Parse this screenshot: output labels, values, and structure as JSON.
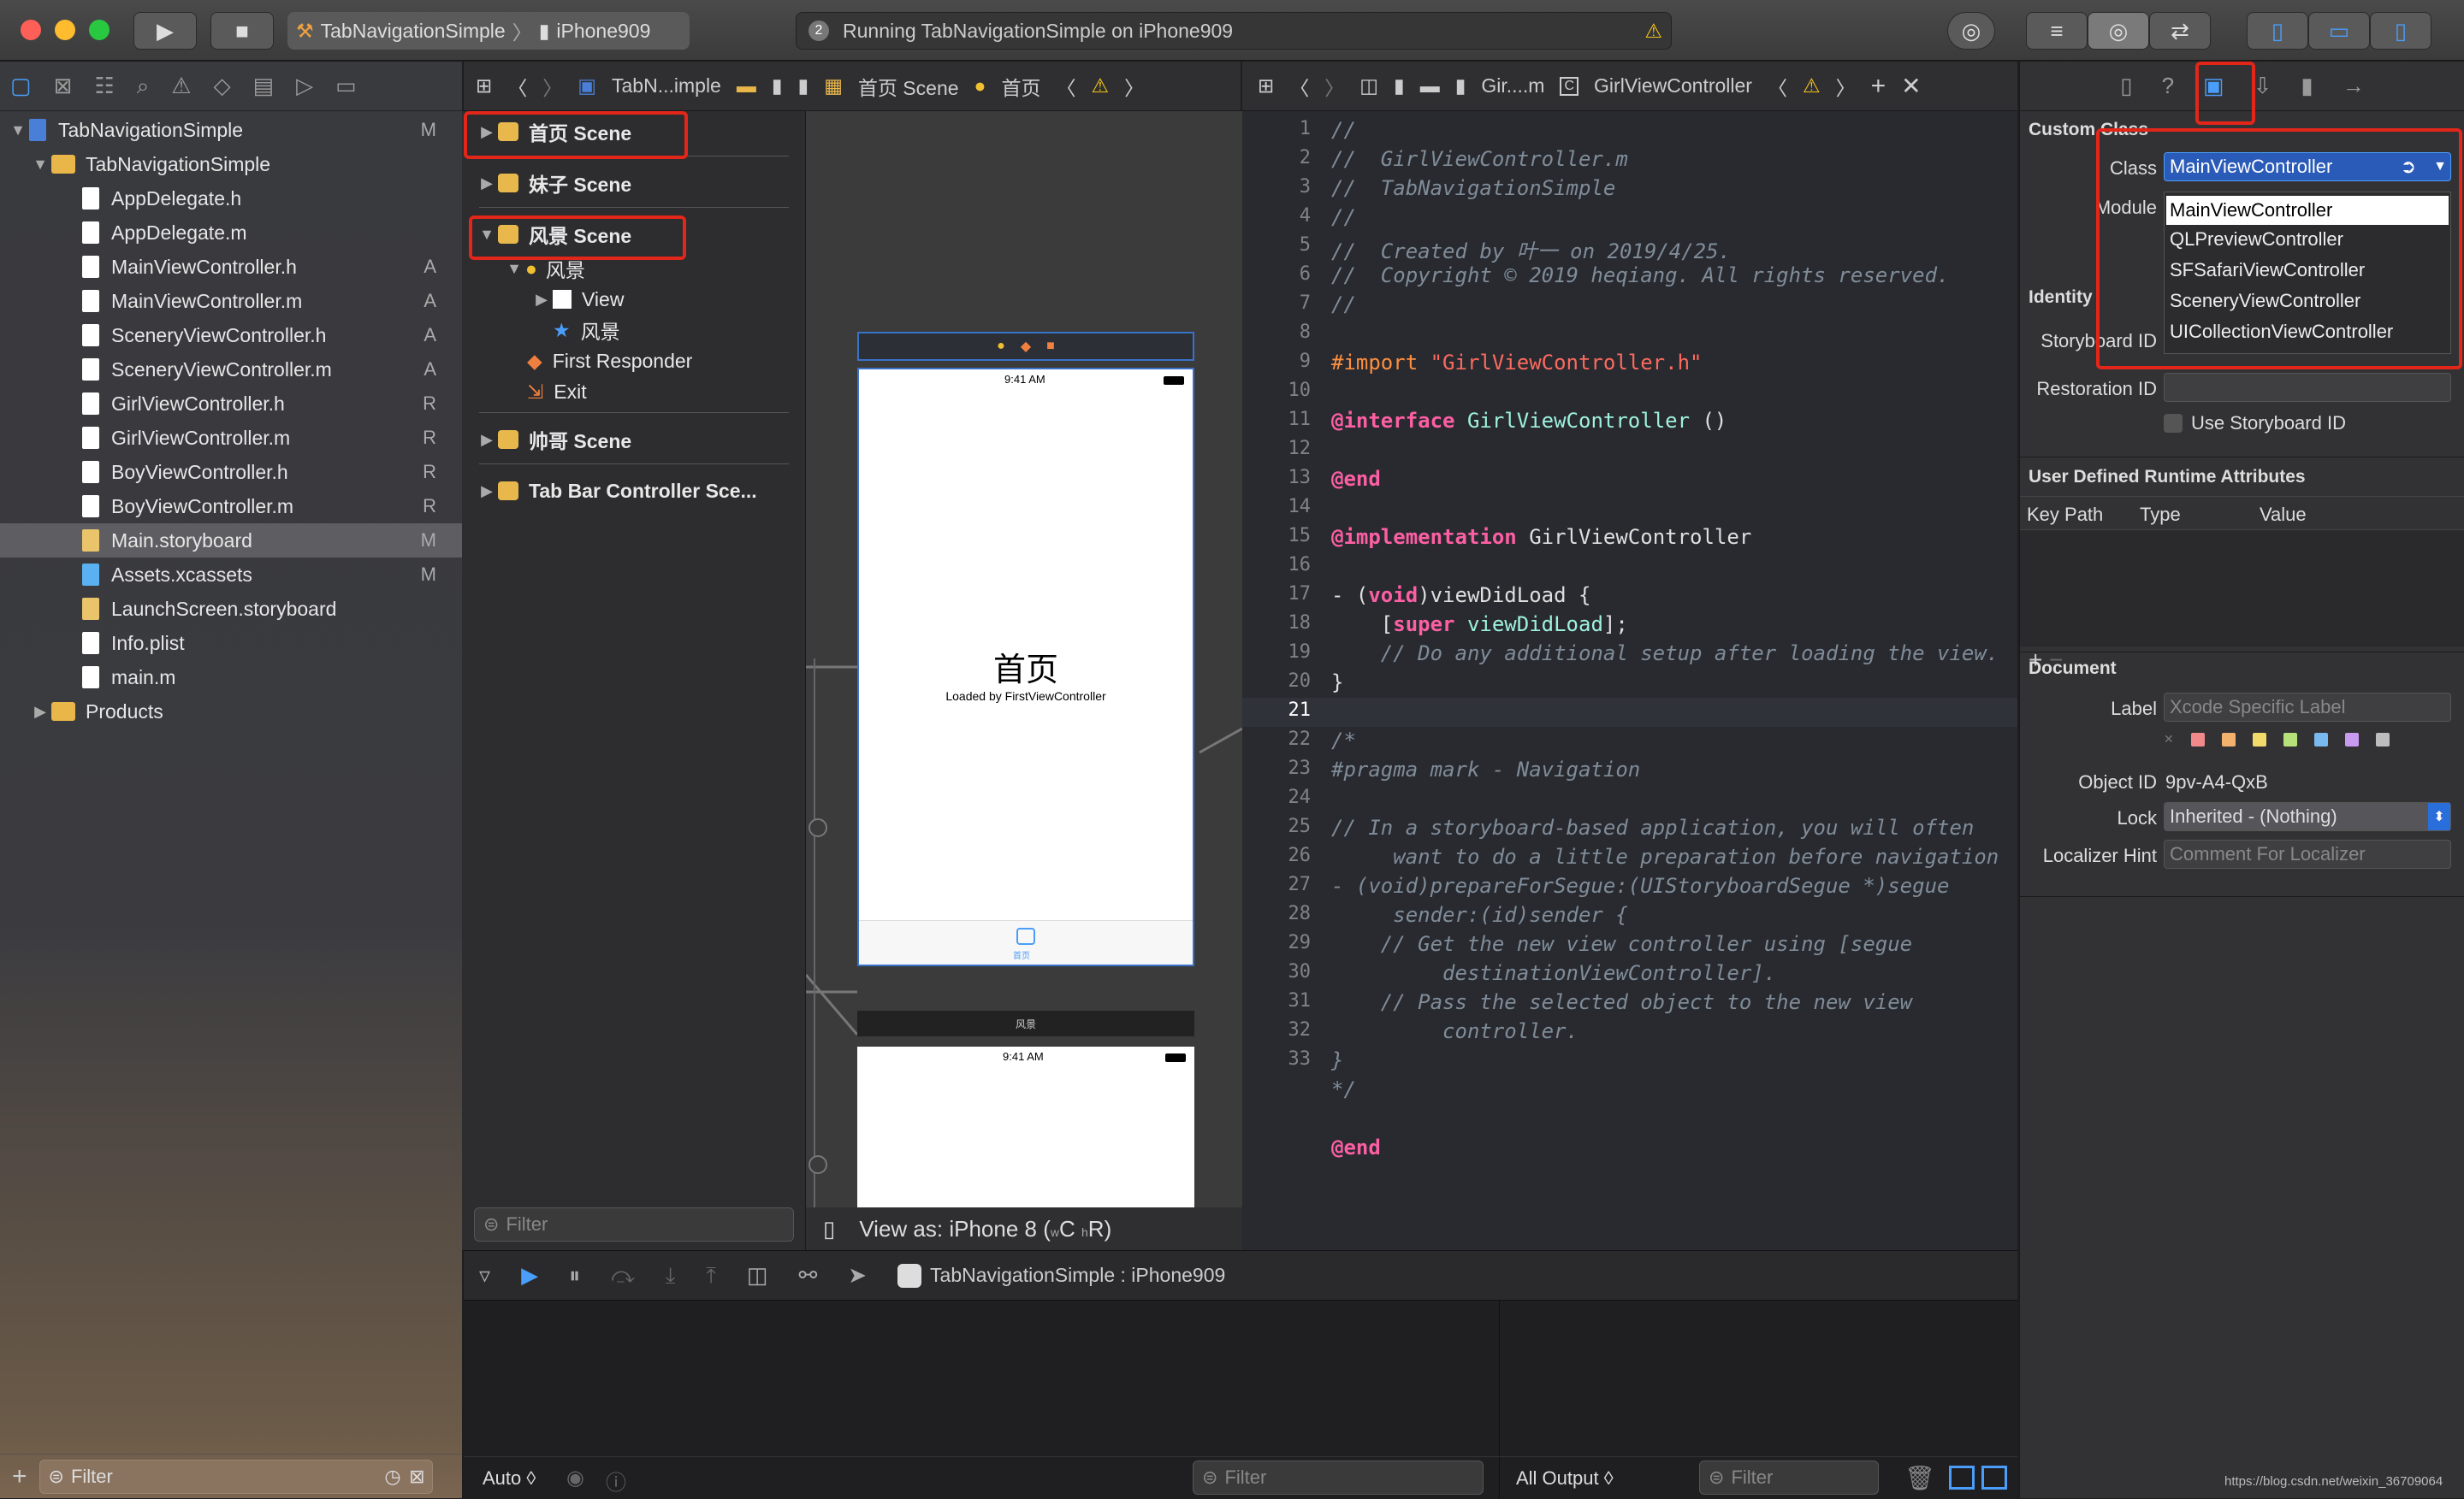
{
  "titlebar": {
    "scheme": "TabNavigationSimple",
    "device": "iPhone909",
    "status_count": "2",
    "status": "Running TabNavigationSimple on iPhone909"
  },
  "navigator": {
    "items": [
      {
        "label": "TabNavigationSimple",
        "status": "M"
      },
      {
        "label": "TabNavigationSimple",
        "status": ""
      },
      {
        "label": "AppDelegate.h",
        "status": ""
      },
      {
        "label": "AppDelegate.m",
        "status": ""
      },
      {
        "label": "MainViewController.h",
        "status": "A"
      },
      {
        "label": "MainViewController.m",
        "status": "A"
      },
      {
        "label": "SceneryViewController.h",
        "status": "A"
      },
      {
        "label": "SceneryViewController.m",
        "status": "A"
      },
      {
        "label": "GirlViewController.h",
        "status": "R"
      },
      {
        "label": "GirlViewController.m",
        "status": "R"
      },
      {
        "label": "BoyViewController.h",
        "status": "R"
      },
      {
        "label": "BoyViewController.m",
        "status": "R"
      },
      {
        "label": "Main.storyboard",
        "status": "M"
      },
      {
        "label": "Assets.xcassets",
        "status": "M"
      },
      {
        "label": "LaunchScreen.storyboard",
        "status": ""
      },
      {
        "label": "Info.plist",
        "status": ""
      },
      {
        "label": "main.m",
        "status": ""
      },
      {
        "label": "Products",
        "status": ""
      }
    ],
    "filter_placeholder": "Filter"
  },
  "storyboard": {
    "jumpbar": [
      "TabN...imple",
      "首页 Scene",
      "首页"
    ],
    "outline": [
      "首页 Scene",
      "妹子 Scene",
      "风景 Scene",
      "风景",
      "View",
      "风景",
      "First Responder",
      "Exit",
      "帅哥 Scene",
      "Tab Bar Controller Sce..."
    ],
    "filter_placeholder": "Filter",
    "view_as": "View as: iPhone 8 (",
    "view_as_suffix": "C",
    "view_as_end": "R)",
    "phone1": {
      "time": "9:41 AM",
      "title": "首页",
      "subtitle": "Loaded by FirstViewController",
      "tab": "首页"
    },
    "phone2": {
      "header": "风景",
      "time": "9:41 AM"
    }
  },
  "editor": {
    "jumpbar": [
      "Gir....m",
      "GirlViewController"
    ],
    "lines": [
      "1",
      "2",
      "3",
      "4",
      "5",
      "6",
      "7",
      "8",
      "9",
      "10",
      "11",
      "12",
      "13",
      "14",
      "15",
      "16",
      "17",
      "18",
      "19",
      "20",
      "21",
      "22",
      "23",
      "24",
      "25",
      "26",
      "27",
      "28",
      "29",
      "30",
      "31",
      "32",
      "33"
    ],
    "code": {
      "l1": "//",
      "l2": "//  GirlViewController.m",
      "l3": "//  TabNavigationSimple",
      "l4": "//",
      "l5": "//  Created by 叶一 on 2019/4/25.",
      "l6": "//  Copyright © 2019 heqiang. All rights reserved.",
      "l7": "//",
      "l9a": "#import ",
      "l9b": "\"GirlViewController.h\"",
      "l11a": "@interface",
      "l11b": " GirlViewController ",
      "l11c": "()",
      "l13": "@end",
      "l15a": "@implementation",
      "l15b": " GirlViewController",
      "l17a": "- (",
      "l17b": "void",
      "l17c": ")viewDidLoad {",
      "l18a": "    [",
      "l18b": "super",
      "l18c": " viewDidLoad",
      "l18d": "];",
      "l19": "    // Do any additional setup after loading the view.",
      "l20": "}",
      "l22": "/*",
      "l23": "#pragma mark - Navigation",
      "l25a": "// In a storyboard-based application, you will often",
      "l25b": "     want to do a little preparation before navigation",
      "l26a": "- (void)prepareForSegue:(UIStoryboardSegue *)segue",
      "l26b": "     sender:(id)sender {",
      "l27a": "    // Get the new view controller using [segue",
      "l27b": "         destinationViewController].",
      "l28a": "    // Pass the selected object to the new view",
      "l28b": "         controller.",
      "l29": "}",
      "l30": "*/",
      "l32": "@end"
    }
  },
  "inspector": {
    "custom_class_header": "Custom Class",
    "class_label": "Class",
    "class_value": "MainViewController",
    "module_label": "Module",
    "dropdown": [
      "MainViewController",
      "QLPreviewController",
      "SFSafariViewController",
      "SceneryViewController",
      "UICollectionViewController"
    ],
    "identity_header": "Identity",
    "storyboard_id_label": "Storyboard ID",
    "restoration_id_label": "Restoration ID",
    "use_storyboard_id": "Use Storyboard ID",
    "runtime_header": "User Defined Runtime Attributes",
    "col_key": "Key Path",
    "col_type": "Type",
    "col_value": "Value",
    "document_header": "Document",
    "label_label": "Label",
    "label_placeholder": "Xcode Specific Label",
    "object_id_label": "Object ID",
    "object_id": "9pv-A4-QxB",
    "lock_label": "Lock",
    "lock_value": "Inherited - (Nothing)",
    "localizer_label": "Localizer Hint",
    "localizer_placeholder": "Comment For Localizer",
    "label_colors": [
      "#f08a8a",
      "#f2b26e",
      "#f2da6b",
      "#b5e07a",
      "#7ab8f0",
      "#c89af0",
      "#bdbdbd"
    ]
  },
  "debug": {
    "target": "TabNavigationSimple : iPhone909",
    "auto": "Auto ◊",
    "filter": "Filter",
    "all_output": "All Output ◊",
    "filter2": "Filter",
    "watermark": "https://blog.csdn.net/weixin_36709064"
  }
}
